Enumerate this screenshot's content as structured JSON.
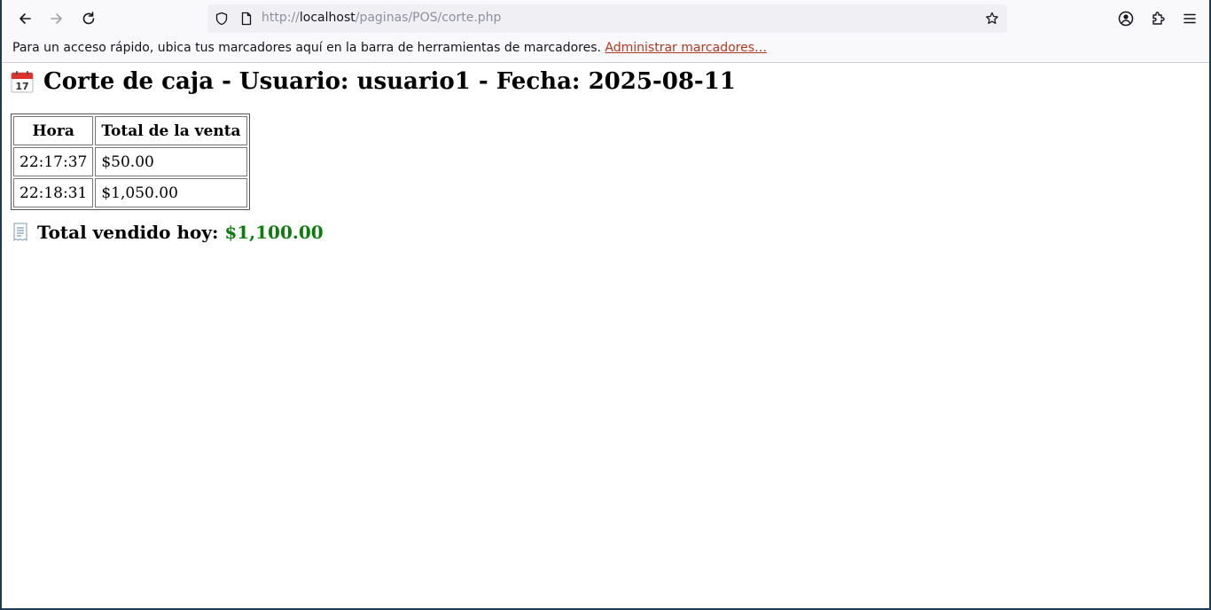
{
  "browser": {
    "url_prefix": "http://",
    "url_host": "localhost",
    "url_path": "/paginas/POS/corte.php"
  },
  "bookmarks_bar": {
    "message": "Para un acceso rápido, ubica tus marcadores aquí en la barra de herramientas de marcadores.",
    "link": "Administrar marcadores…"
  },
  "page": {
    "heading": "Corte de caja - Usuario: usuario1 - Fecha: 2025-08-11",
    "table": {
      "headers": [
        "Hora",
        "Total de la venta"
      ],
      "rows": [
        [
          "22:17:37",
          "$50.00"
        ],
        [
          "22:18:31",
          "$1,050.00"
        ]
      ]
    },
    "total_label": "Total vendido hoy:",
    "total_value": "$1,100.00",
    "accent_green": "#0a7d0a"
  }
}
